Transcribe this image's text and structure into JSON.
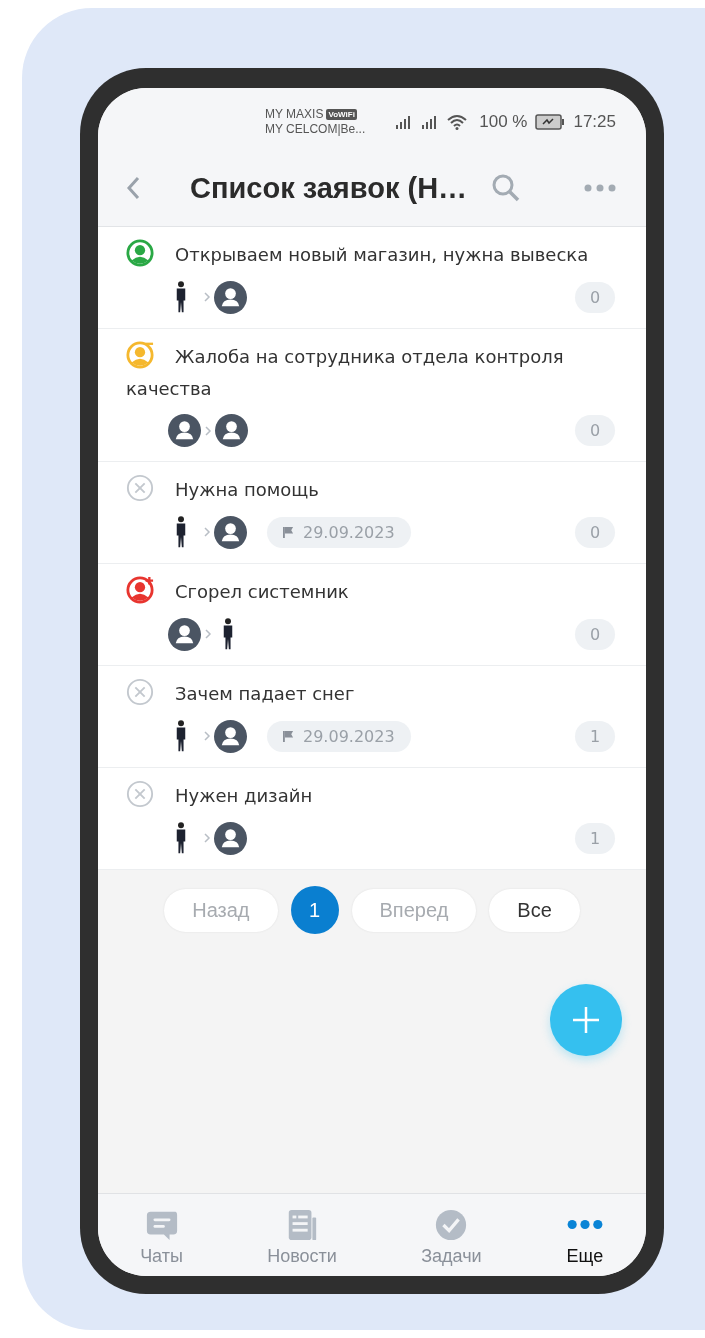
{
  "status_bar": {
    "carrier_1": "MY MAXIS",
    "carrier_1_badge": "VoWiFi",
    "carrier_2": "MY CELCOM|Be...",
    "battery": "100 %",
    "time": "17:25"
  },
  "header": {
    "title": "Список заявок (Н…"
  },
  "requests": [
    {
      "title": "Открываем новый магазин, нужна вывеска",
      "status": {
        "kind": "open"
      },
      "from": {
        "kind": "photo"
      },
      "to": {
        "kind": "default"
      },
      "counter": "0"
    },
    {
      "title": "Жалоба на сотрудника отдела контроля качества",
      "status": {
        "kind": "pending"
      },
      "from": {
        "kind": "default"
      },
      "to": {
        "kind": "default"
      },
      "counter": "0"
    },
    {
      "title": "Нужна помощь",
      "status": {
        "kind": "closed"
      },
      "from": {
        "kind": "photo"
      },
      "to": {
        "kind": "default"
      },
      "date": "29.09.2023",
      "counter": "0"
    },
    {
      "title": "Сгорел системник",
      "status": {
        "kind": "new"
      },
      "from": {
        "kind": "default"
      },
      "to": {
        "kind": "photo"
      },
      "counter": "0"
    },
    {
      "title": "Зачем падает снег",
      "status": {
        "kind": "closed"
      },
      "from": {
        "kind": "photo"
      },
      "to": {
        "kind": "default"
      },
      "date": "29.09.2023",
      "counter": "1"
    },
    {
      "title": "Нужен дизайн",
      "status": {
        "kind": "closed"
      },
      "from": {
        "kind": "photo"
      },
      "to": {
        "kind": "default"
      },
      "counter": "1"
    }
  ],
  "pagination": [
    {
      "kind": "nav",
      "label": "Назад",
      "disabled": true
    },
    {
      "kind": "page",
      "label": "1",
      "selected": true
    },
    {
      "kind": "nav",
      "label": "Вперед",
      "disabled": true
    },
    {
      "kind": "nav",
      "label": "Все",
      "disabled": false
    }
  ],
  "bottom_nav": [
    {
      "kind": "chat",
      "label": "Чаты",
      "selected": false
    },
    {
      "kind": "news",
      "label": "Новости",
      "selected": false
    },
    {
      "kind": "tasks",
      "label": "Задачи",
      "selected": false
    },
    {
      "kind": "more",
      "label": "Еще",
      "selected": true
    }
  ]
}
